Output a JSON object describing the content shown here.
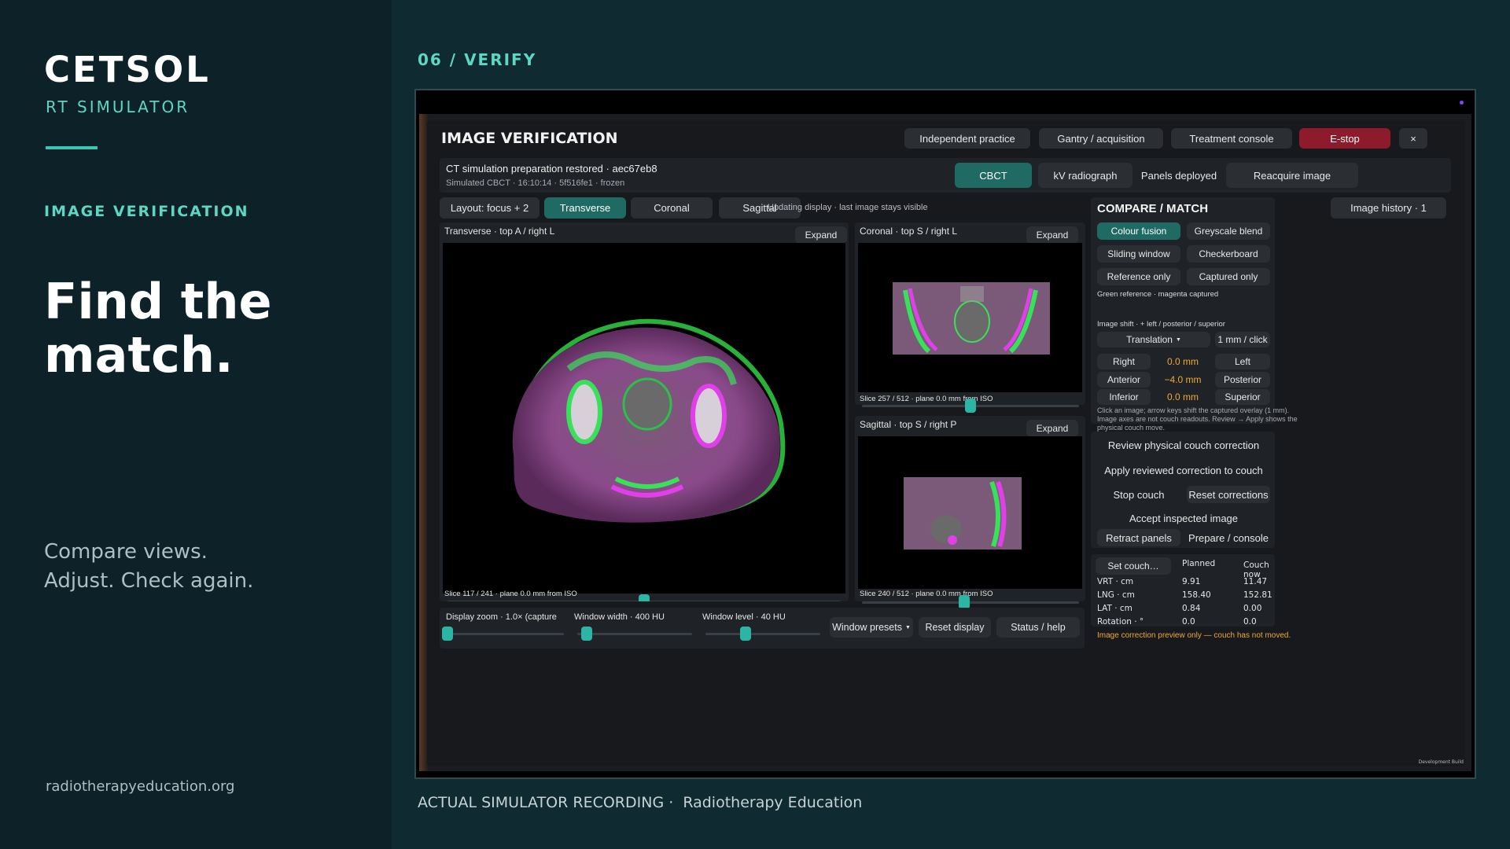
{
  "promo": {
    "brand": "CETSOL",
    "brand_sub": "RT SIMULATOR",
    "section": "IMAGE VERIFICATION",
    "headline": "Find the match.",
    "tagline": "Compare views.\nAdjust. Check again.",
    "site": "radiotherapyeducation.org"
  },
  "step": "06 / VERIFY",
  "caption": {
    "left": "ACTUAL SIMULATOR RECORDING ·",
    "right": "Radiotherapy Education"
  },
  "app": {
    "title": "IMAGE VERIFICATION",
    "top_buttons": [
      "Independent practice",
      "Gantry / acquisition",
      "Treatment console",
      "E-stop",
      "×"
    ],
    "info_main": "CT simulation preparation restored · aec67eb8",
    "info_sub": "Simulated CBCT · 16:10:14 · 5f516fe1 · frozen",
    "modality_buttons": [
      "CBCT",
      "kV radiograph",
      "Panels deployed",
      "Reacquire image"
    ],
    "layout_buttons": [
      "Layout: focus + 2",
      "Transverse",
      "Coronal",
      "Sagittal"
    ],
    "status_note": "Updating display · last image stays visible",
    "history": "Image history · 1",
    "expand": "Expand",
    "views": {
      "transverse": {
        "title": "Transverse · top A / right L",
        "slice": "Slice 117 / 241 · plane 0.0 mm from ISO",
        "slider": 0.5
      },
      "coronal": {
        "title": "Coronal · top S / right L",
        "slice": "Slice 257 / 512 · plane 0.0 mm from ISO",
        "slider": 0.5
      },
      "sagittal": {
        "title": "Sagittal · top S / right P",
        "slice": "Slice 240 / 512 · plane 0.0 mm from ISO",
        "slider": 0.47
      }
    },
    "display": {
      "zoom_label": "Display zoom · 1.0× (capture",
      "width_label": "Window width · 400 HU",
      "level_label": "Window level · 40 HU",
      "zoom_value": 0.0,
      "width_value": 0.08,
      "level_value": 0.35,
      "presets": "Window presets",
      "reset": "Reset display",
      "status": "Status / help"
    },
    "compare": {
      "title": "COMPARE / MATCH",
      "modes": [
        "Colour fusion",
        "Greyscale blend",
        "Sliding window",
        "Checkerboard",
        "Reference only",
        "Captured only"
      ],
      "legend": "Green reference · magenta captured",
      "shift_label": "Image shift · + left / posterior / superior",
      "shift_mode": "Translation",
      "step": "1 mm / click",
      "axes": [
        {
          "neg": "Right",
          "value": "0.0 mm",
          "pos": "Left"
        },
        {
          "neg": "Anterior",
          "value": "−4.0 mm",
          "pos": "Posterior"
        },
        {
          "neg": "Inferior",
          "value": "0.0 mm",
          "pos": "Superior"
        }
      ],
      "help": "Click an image; arrow keys shift the captured overlay (1 mm). Image axes are not couch readouts. Review → Apply shows the physical couch move."
    },
    "actions": {
      "review": "Review physical couch correction",
      "apply": "Apply reviewed correction to couch",
      "stop": "Stop couch",
      "reset": "Reset corrections",
      "accept": "Accept inspected image",
      "retract": "Retract panels",
      "prepare": "Prepare / console"
    },
    "couch": {
      "set_button": "Set couch…",
      "head_planned": "Planned",
      "head_now": "Couch now",
      "rows": [
        {
          "label": "VRT · cm",
          "planned": "9.91",
          "now": "11.47"
        },
        {
          "label": "LNG · cm",
          "planned": "158.40",
          "now": "152.81"
        },
        {
          "label": "LAT · cm",
          "planned": "0.84",
          "now": "0.00"
        },
        {
          "label": "Rotation · °",
          "planned": "0.0",
          "now": "0.0"
        }
      ]
    },
    "warning": "Image correction preview only — couch has not moved.",
    "dev_build": "Development Build"
  },
  "colors": {
    "accent": "#5fd6c3",
    "teal_button": "#1f6b64",
    "estop": "#8e1b2b",
    "readout": "#f0a830",
    "reference": "#39e05a",
    "captured": "#e040e8"
  }
}
